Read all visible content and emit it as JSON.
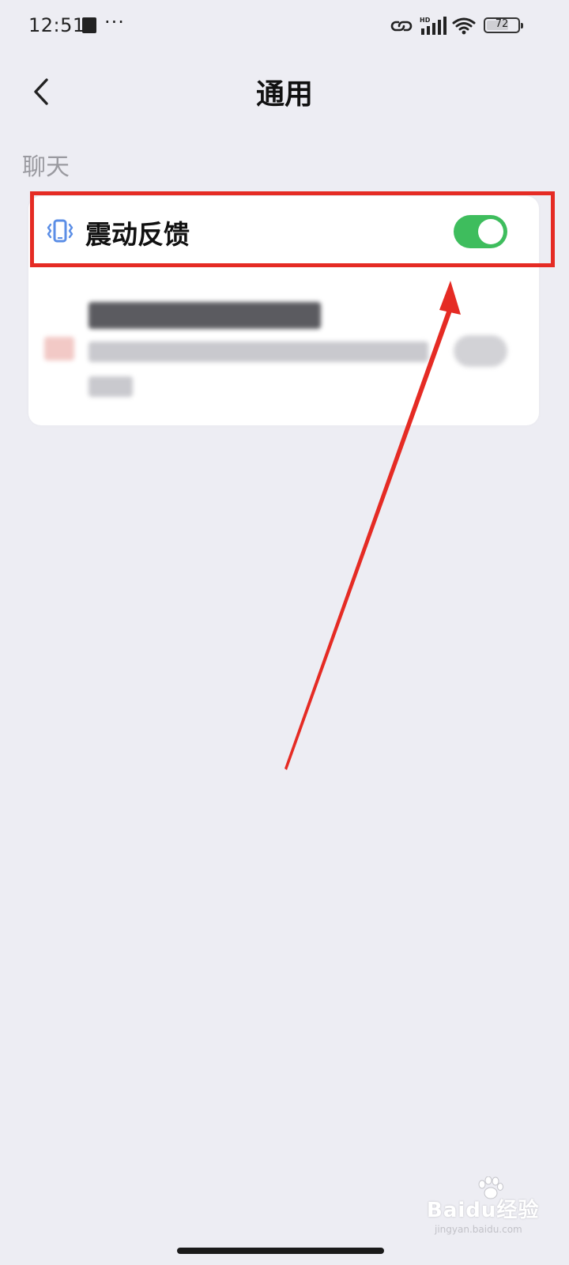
{
  "status_bar": {
    "time": "12:51",
    "dots": "···",
    "signal_label": "HD",
    "battery_level": "72",
    "battery_fraction": 0.72
  },
  "nav": {
    "title": "通用",
    "back_icon": "chevron-left-icon"
  },
  "section": {
    "header": "聊天"
  },
  "settings": {
    "vibration": {
      "label": "震动反馈",
      "icon": "phone-vibrate-icon",
      "enabled": true
    }
  },
  "colors": {
    "background": "#ededf3",
    "toggle_on": "#3ebd5d",
    "vibration_icon": "#5b8ee6",
    "annotation": "#e52b24"
  },
  "watermark": {
    "text": "Baidu经验",
    "sub": "jingyan.baidu.com"
  }
}
